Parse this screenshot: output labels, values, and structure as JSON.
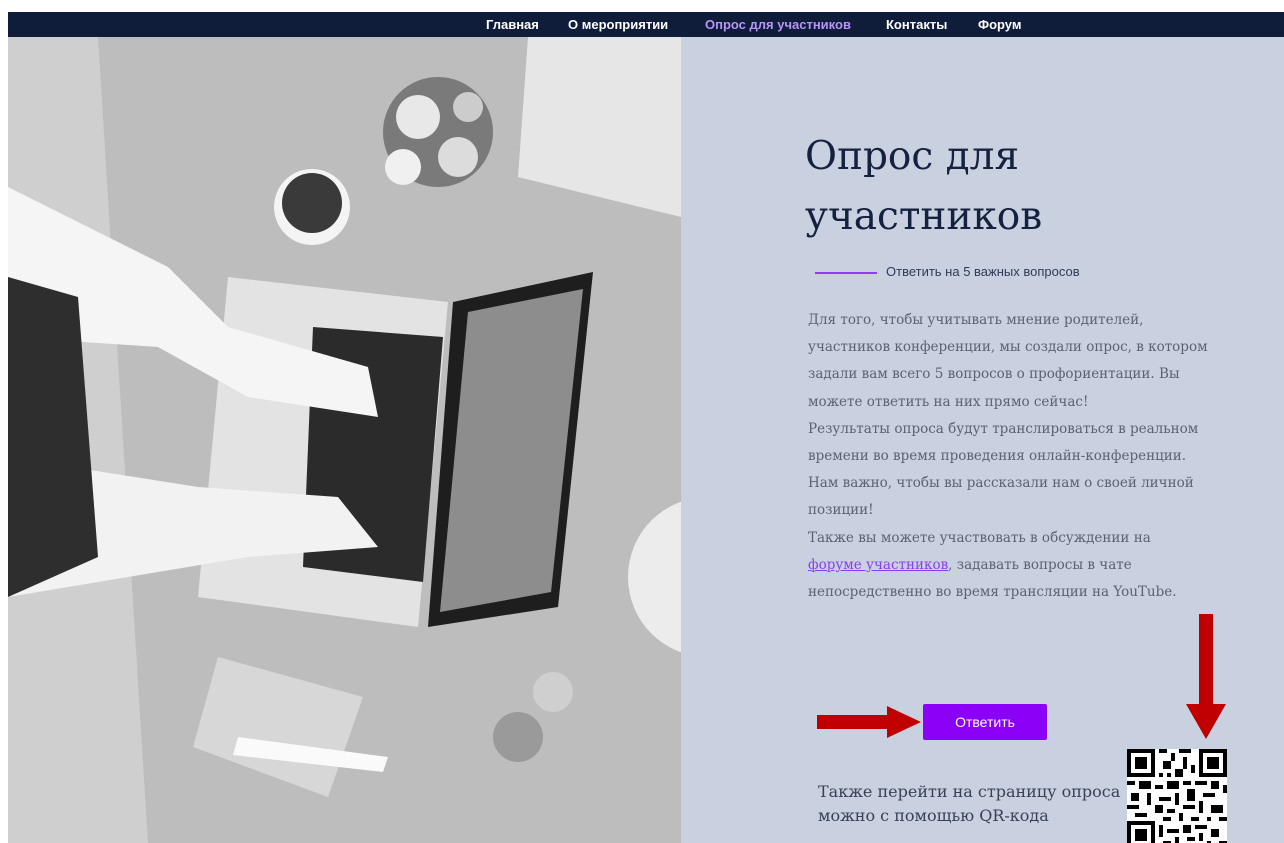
{
  "nav": {
    "items": [
      {
        "label": "Главная",
        "active": false
      },
      {
        "label": "О мероприятии",
        "active": false
      },
      {
        "label": "Опрос для участников",
        "active": true
      },
      {
        "label": "Контакты",
        "active": false
      },
      {
        "label": "Форум",
        "active": false
      }
    ]
  },
  "hero_image": {
    "description_icon": "laptop-photo"
  },
  "survey": {
    "title": "Опрос для участников",
    "subtitle": "Ответить на 5 важных вопросов",
    "paragraph1": "Для того, чтобы учитывать мнение родителей, участников конференции, мы создали опрос, в котором задали вам всего 5 вопросов о профориентации. Вы можете ответить на них прямо сейчас!",
    "paragraph2": "Результаты опроса будут транслироваться в реальном времени во время проведения онлайн-конференции. Нам важно, чтобы вы рассказали нам о своей личной позиции!",
    "paragraph3_before": "Также вы можете участвовать в обсуждении на ",
    "forum_link": "форуме участников",
    "paragraph3_after": ", задавать вопросы в чате непосредственно во время  трансляции на YouTube.",
    "answer_button": "Ответить",
    "qr_caption": "Также перейти на страницу опроса можно с помощью QR-кода"
  },
  "colors": {
    "nav_bg": "#0f1c3a",
    "nav_active": "#b794f6",
    "panel_bg": "#c9d1e0",
    "accent": "#8b00f7",
    "arrow": "#c00000"
  }
}
